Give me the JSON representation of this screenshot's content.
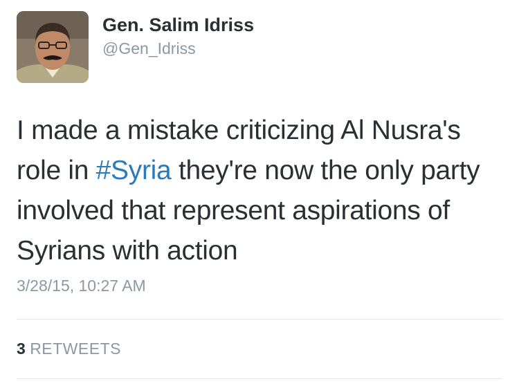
{
  "author": {
    "display_name": "Gen. Salim Idriss",
    "handle": "@Gen_Idriss"
  },
  "tweet": {
    "text_before": "I made a mistake criticizing Al Nusra's role in ",
    "hashtag": "#Syria",
    "text_after": " they're now the only party involved that represent aspirations of Syrians with action",
    "timestamp": "3/28/15, 10:27 AM"
  },
  "stats": {
    "retweet_count": "3",
    "retweet_label": "RETWEETS"
  },
  "colors": {
    "text": "#292f33",
    "muted": "#8899a6",
    "link": "#2b7bb9",
    "divider": "#e1e8ed"
  }
}
